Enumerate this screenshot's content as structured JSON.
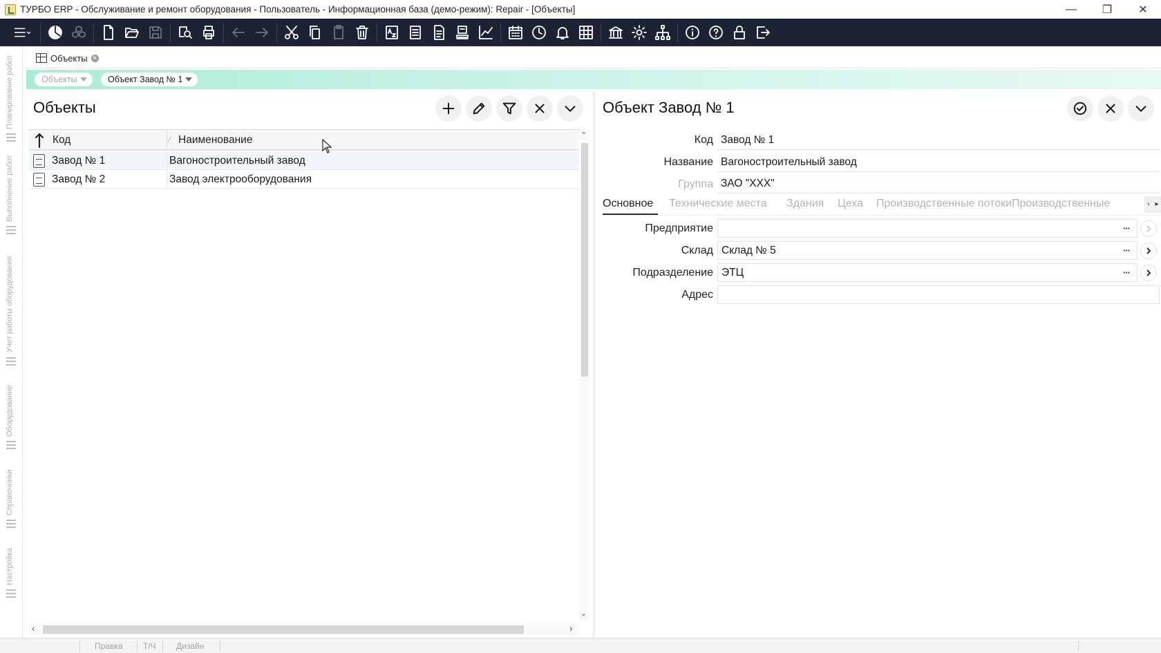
{
  "window": {
    "title": "ТУРБО ERP - Обслуживание и ремонт оборудования - Пользователь - Информационная база (демо-режим): Repair - [Объекты]",
    "minimize": "—",
    "restore": "❐",
    "close": "✕"
  },
  "toolbar": {
    "buttons": [
      "menu-icon",
      "pie-chart-icon",
      "cubes-icon",
      "new-document-icon",
      "open-folder-icon",
      "save-icon",
      "preview-icon",
      "print-icon",
      "back-arrow-icon",
      "forward-arrow-icon",
      "cut-icon",
      "copy-icon",
      "paste-icon",
      "delete-icon",
      "sort-az-icon",
      "list-icon",
      "report-icon",
      "stamp-icon",
      "trend-chart-icon",
      "calendar-icon",
      "clock-icon",
      "bell-icon",
      "grid-icon",
      "bank-icon",
      "settings-icon",
      "hierarchy-icon",
      "info-icon",
      "help-icon",
      "lock-icon",
      "exit-icon"
    ]
  },
  "sidebar": {
    "items": [
      {
        "label": "Планирование работ"
      },
      {
        "label": "Выполнение работ"
      },
      {
        "label": "Учет работы оборудования"
      },
      {
        "label": "Оборудование"
      },
      {
        "label": "Справочники"
      },
      {
        "label": "Настройка"
      }
    ]
  },
  "tabs": {
    "active": {
      "label": "Объекты"
    }
  },
  "breadcrumb": {
    "items": [
      {
        "label": "Объекты"
      },
      {
        "label": "Объект Завод № 1"
      }
    ]
  },
  "list": {
    "title": "Объекты",
    "columns": [
      "Код",
      "Наименование"
    ],
    "rows": [
      {
        "code": "Завод № 1",
        "name": "Вагоностроительный завод"
      },
      {
        "code": "Завод № 2",
        "name": "Завод электрооборудования"
      }
    ],
    "sort_mark": "∕"
  },
  "detail": {
    "title": "Объект Завод № 1",
    "fields": {
      "code_label": "Код",
      "code_value": "Завод № 1",
      "name_label": "Название",
      "name_value": "Вагоностроительный завод",
      "group_label": "Группа",
      "group_value": "ЗАО \"XXX\""
    },
    "subtabs": [
      "Основное",
      "Технические места",
      "Здания",
      "Цеха",
      "Производственные потоки",
      "Производственные"
    ],
    "main": {
      "enterprise_label": "Предприятие",
      "enterprise_value": "",
      "warehouse_label": "Склад",
      "warehouse_value": "Склад № 5",
      "department_label": "Подразделение",
      "department_value": "ЭТЦ",
      "address_label": "Адрес",
      "address_value": ""
    },
    "dots": "···"
  },
  "statusbar": {
    "items": [
      "Правка",
      "Т/Ч",
      "Дизайн"
    ]
  }
}
